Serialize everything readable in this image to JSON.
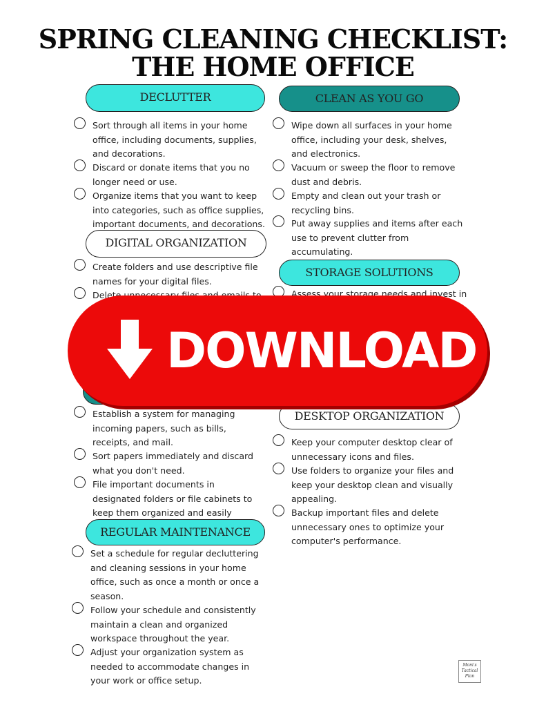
{
  "title": {
    "line1": "SPRING CLEANING CHECKLIST:",
    "line2": "THE HOME OFFICE"
  },
  "sections": {
    "declutter": {
      "label": "DECLUTTER",
      "items": [
        "Sort through all items in your home office, including documents, supplies, and decorations.",
        "Discard or donate items that you no longer need or use.",
        "Organize items that you want to keep into categories, such as office supplies, important documents, and decorations."
      ]
    },
    "digital": {
      "label": "DIGITAL ORGANIZATION",
      "items": [
        "Create folders and use descriptive file names for your digital files.",
        "Delete unnecessary files and emails to"
      ]
    },
    "paper": {
      "items": [
        "Establish a system for managing incoming papers, such as bills, receipts, and mail.",
        "Sort papers immediately and discard what you don't need.",
        "File important documents in designated folders or file cabinets to keep them organized and easily accessible."
      ]
    },
    "maintenance": {
      "label": "REGULAR MAINTENANCE",
      "items": [
        "Set a schedule for regular decluttering and cleaning sessions in your home office, such as once a month or once a season.",
        "Follow your schedule and consistently maintain a clean and organized workspace throughout the year.",
        "Adjust your organization system as needed to accommodate changes in your work or office setup."
      ]
    },
    "clean": {
      "label": "CLEAN AS YOU GO",
      "items": [
        "Wipe down all surfaces in your home office, including your desk, shelves, and electronics.",
        "Vacuum or sweep the floor to remove dust and debris.",
        "Empty and clean out your trash or recycling bins.",
        "Put away supplies and items after each use to prevent clutter from accumulating."
      ]
    },
    "storage": {
      "label": "STORAGE SOLUTIONS",
      "items": [
        "Assess your storage needs and invest in"
      ]
    },
    "desktop": {
      "label": "DESKTOP ORGANIZATION",
      "items": [
        "Keep your computer desktop clear of unnecessary icons and files.",
        "Use folders to organize your files and keep your desktop clean and visually appealing.",
        "Backup important files and delete unnecessary ones to optimize your computer's performance."
      ]
    }
  },
  "banner": {
    "label": "DOWNLOAD",
    "icon": "arrow-down-icon",
    "color": "#ec0a0a"
  },
  "logo": {
    "text": "Mom's Tactical Plan"
  },
  "colors": {
    "teal": "#3de6de",
    "dark_teal": "#16908a"
  }
}
